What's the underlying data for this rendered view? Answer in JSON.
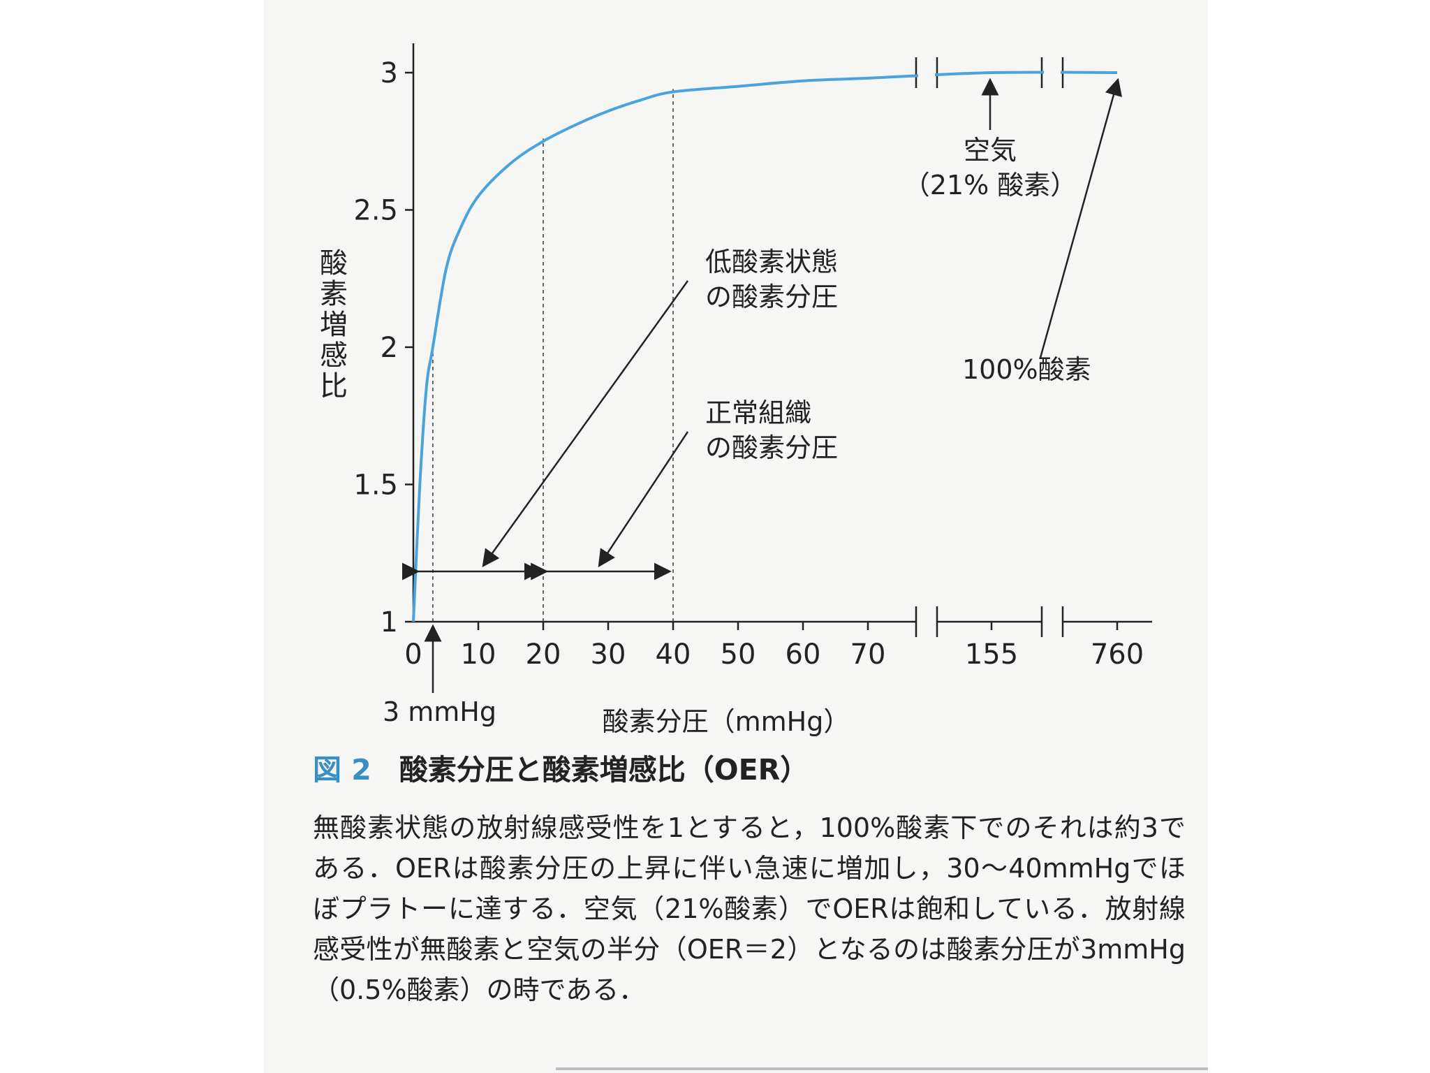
{
  "chart_data": {
    "type": "line",
    "xlabel": "酸素分圧（mmHg）",
    "ylabel": "酸素増感比",
    "ylim": [
      1,
      3
    ],
    "yticks": [
      "1",
      "1.5",
      "2",
      "2.5",
      "3"
    ],
    "xticks": [
      "0",
      "10",
      "20",
      "30",
      "40",
      "50",
      "60",
      "70",
      "155",
      "760"
    ],
    "x_axis_breaks": [
      "70–155",
      "155–760"
    ],
    "series": [
      {
        "color": "#4aa3dc",
        "x": [
          0,
          1,
          2,
          3,
          5,
          7,
          10,
          15,
          20,
          25,
          30,
          35,
          40,
          50,
          60,
          70,
          155,
          760
        ],
        "y": [
          1.0,
          1.5,
          1.85,
          2.0,
          2.28,
          2.42,
          2.55,
          2.67,
          2.75,
          2.81,
          2.86,
          2.9,
          2.93,
          2.95,
          2.97,
          2.98,
          3.0,
          3.0
        ]
      }
    ],
    "reference_lines_x": [
      3,
      20,
      40
    ],
    "annotations": {
      "hypoxia_label": [
        "低酸素状態",
        "の酸素分圧"
      ],
      "normal_label": [
        "正常組織",
        "の酸素分圧"
      ],
      "air_label": [
        "空気",
        "（21% 酸素）"
      ],
      "oxygen100_label": "100%酸素",
      "threshold_label": "3 mmHg"
    },
    "grid": false,
    "legend": "none"
  },
  "caption": {
    "number": "図 2",
    "title": "酸素分圧と酸素増感比（OER）",
    "body": "無酸素状態の放射線感受性を1とすると，100%酸素下でのそれは約3である．OERは酸素分圧の上昇に伴い急速に増加し，30〜40mmHgでほぼプラトーに達する．空気（21%酸素）でOERは飽和している．放射線感受性が無酸素と空気の半分（OER＝2）となるのは酸素分圧が3mmHg（0.5%酸素）の時である．"
  },
  "colors": {
    "curve": "#4aa3dc",
    "figure_number": "#3a8fc2",
    "axis": "#222222"
  }
}
